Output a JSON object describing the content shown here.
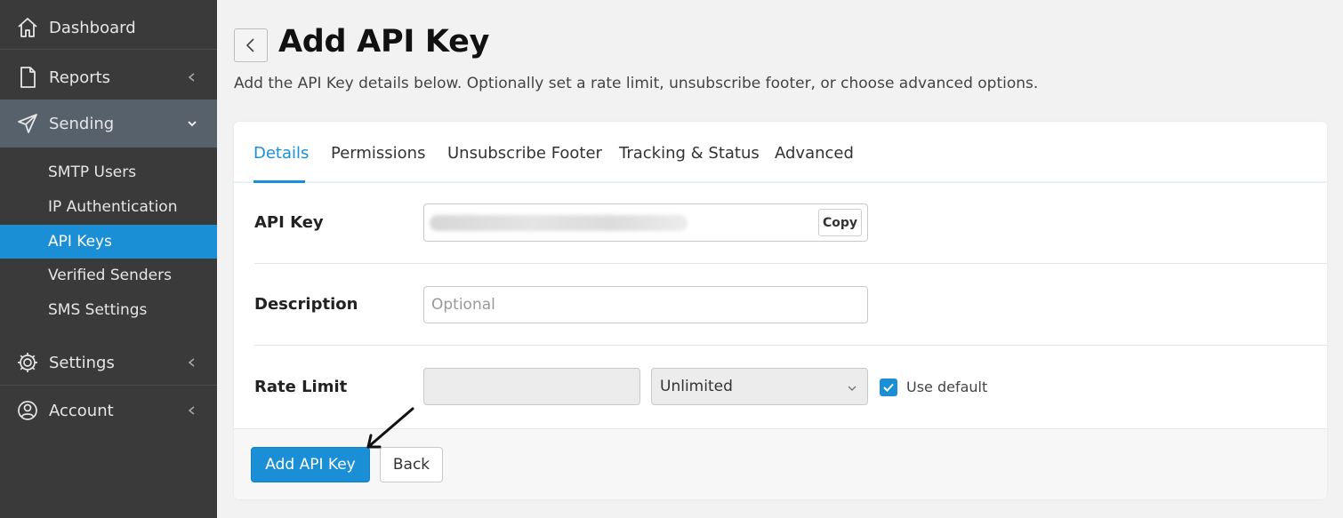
{
  "sidebar": {
    "items": [
      {
        "label": "Dashboard",
        "icon": "home-icon"
      },
      {
        "label": "Reports",
        "icon": "document-icon"
      },
      {
        "label": "Sending",
        "icon": "paper-plane-icon"
      },
      {
        "label": "Settings",
        "icon": "gear-icon"
      },
      {
        "label": "Account",
        "icon": "user-circle-icon"
      }
    ],
    "sending_subitems": [
      "SMTP Users",
      "IP Authentication",
      "API Keys",
      "Verified Senders",
      "SMS Settings"
    ],
    "active_subitem": "API Keys"
  },
  "header": {
    "title": "Add API Key",
    "subtitle": "Add the API Key details below. Optionally set a rate limit, unsubscribe footer, or choose advanced options."
  },
  "tabs": [
    "Details",
    "Permissions",
    "Unsubscribe Footer",
    "Tracking & Status",
    "Advanced"
  ],
  "active_tab": "Details",
  "form": {
    "api_key_label": "API Key",
    "copy_label": "Copy",
    "description_label": "Description",
    "description_placeholder": "Optional",
    "rate_limit_label": "Rate Limit",
    "rate_limit_value": "",
    "rate_limit_period": "Unlimited",
    "use_default_label": "Use default",
    "use_default_checked": true
  },
  "footer": {
    "primary_label": "Add API Key",
    "secondary_label": "Back"
  },
  "colors": {
    "accent": "#1b8fd6",
    "sidebar_bg": "#3a3a3a",
    "sidebar_active_group": "#56616b"
  }
}
